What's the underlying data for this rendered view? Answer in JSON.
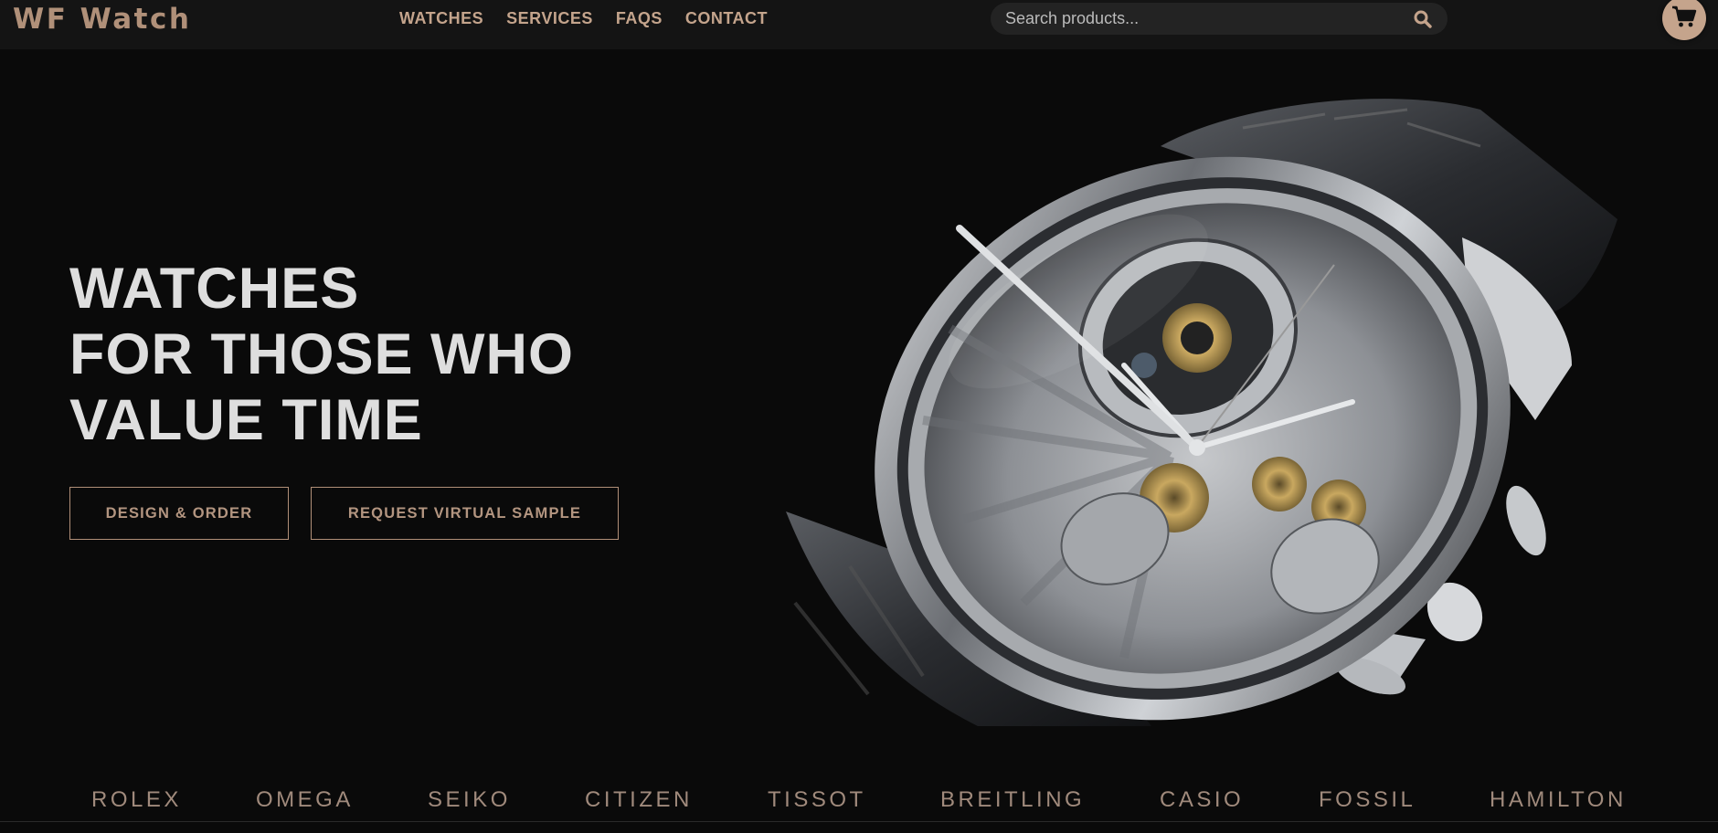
{
  "header": {
    "brand": "WF Watch",
    "nav": [
      {
        "label": "WATCHES"
      },
      {
        "label": "SERVICES"
      },
      {
        "label": "FAQS"
      },
      {
        "label": "CONTACT"
      }
    ],
    "search": {
      "placeholder": "Search products...",
      "value": "",
      "icon": "search-icon"
    },
    "cart": {
      "icon": "cart-icon"
    }
  },
  "hero": {
    "title_lines": [
      "WATCHES",
      "FOR THOSE WHO",
      "VALUE TIME"
    ],
    "buttons": {
      "design_order": "DESIGN & ORDER",
      "virtual_sample": "REQUEST VIRTUAL SAMPLE"
    },
    "image": "chronograph-watch-image"
  },
  "brands": [
    "ROLEX",
    "OMEGA",
    "SEIKO",
    "CITIZEN",
    "TISSOT",
    "BREITLING",
    "CASIO",
    "FOSSIL",
    "HAMILTON"
  ],
  "colors": {
    "accent": "#c5a48c",
    "background": "#0a0a0a",
    "header": "#141414",
    "title": "#dedede",
    "brand_strip": "#a08a7c"
  }
}
